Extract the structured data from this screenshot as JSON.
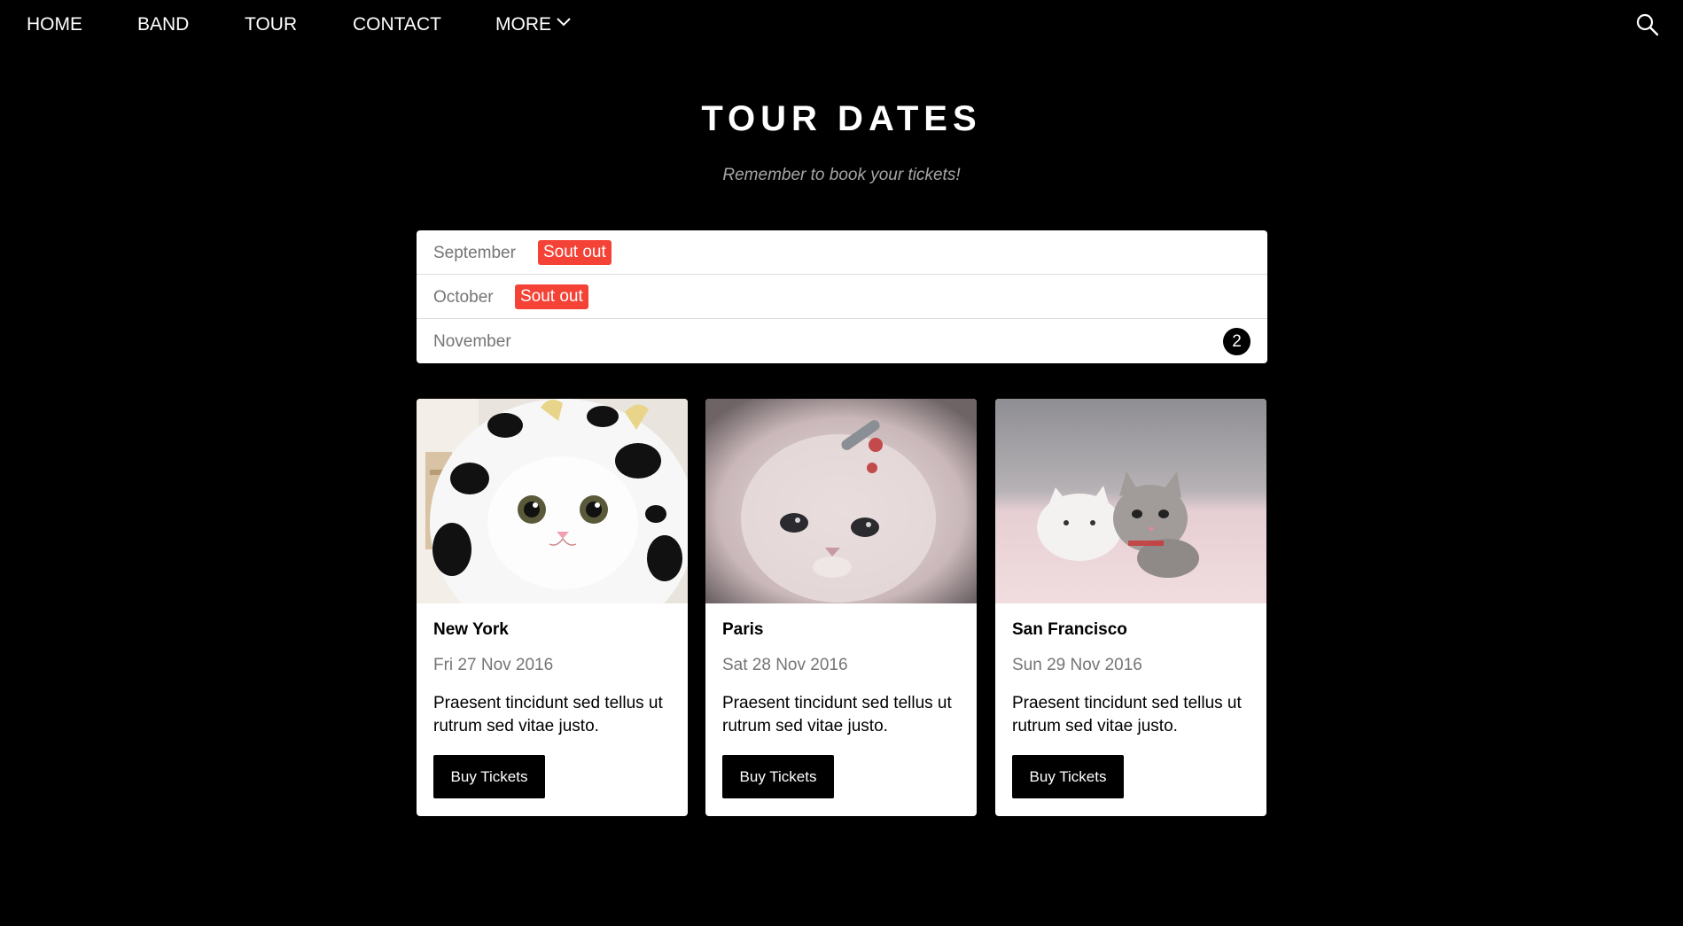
{
  "nav": {
    "home": "HOME",
    "band": "BAND",
    "tour": "TOUR",
    "contact": "CONTACT",
    "more": "MORE",
    "more_icon": "chevron-down-icon",
    "search_icon": "search-icon"
  },
  "header": {
    "title": "TOUR DATES",
    "subtitle": "Remember to book your tickets!"
  },
  "months": [
    {
      "label": "September",
      "badge": "Sout out"
    },
    {
      "label": "October",
      "badge": "Sout out"
    },
    {
      "label": "November",
      "count": "2"
    }
  ],
  "cards": [
    {
      "city": "New York",
      "date": "Fri 27 Nov 2016",
      "description": "Praesent tincidunt sed tellus ut rutrum sed vitae justo.",
      "button": "Buy Tickets",
      "image": "kitten-in-cow-costume"
    },
    {
      "city": "Paris",
      "date": "Sat 28 Nov 2016",
      "description": "Praesent tincidunt sed tellus ut rutrum sed vitae justo.",
      "button": "Buy Tickets",
      "image": "fluffy-kitten-with-hairclip"
    },
    {
      "city": "San Francisco",
      "date": "Sun 29 Nov 2016",
      "description": "Praesent tincidunt sed tellus ut rutrum sed vitae justo.",
      "button": "Buy Tickets",
      "image": "kitten-on-pink-rug"
    }
  ],
  "colors": {
    "background": "#000000",
    "badge_red": "#f44336",
    "muted_text": "#757575"
  }
}
